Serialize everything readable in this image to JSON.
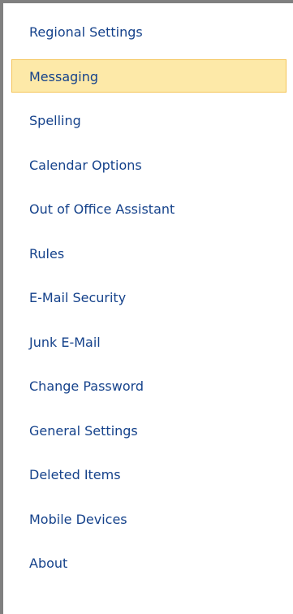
{
  "nav": {
    "selected_index": 1,
    "items": [
      {
        "label": "Regional Settings"
      },
      {
        "label": "Messaging"
      },
      {
        "label": "Spelling"
      },
      {
        "label": "Calendar Options"
      },
      {
        "label": "Out of Office Assistant"
      },
      {
        "label": "Rules"
      },
      {
        "label": "E-Mail Security"
      },
      {
        "label": "Junk E-Mail"
      },
      {
        "label": "Change Password"
      },
      {
        "label": "General Settings"
      },
      {
        "label": "Deleted Items"
      },
      {
        "label": "Mobile Devices"
      },
      {
        "label": "About"
      }
    ]
  },
  "colors": {
    "link_text": "#15428b",
    "selected_background": "#fde9a8",
    "selected_border": "#f5c55a",
    "frame_border": "#808080"
  }
}
